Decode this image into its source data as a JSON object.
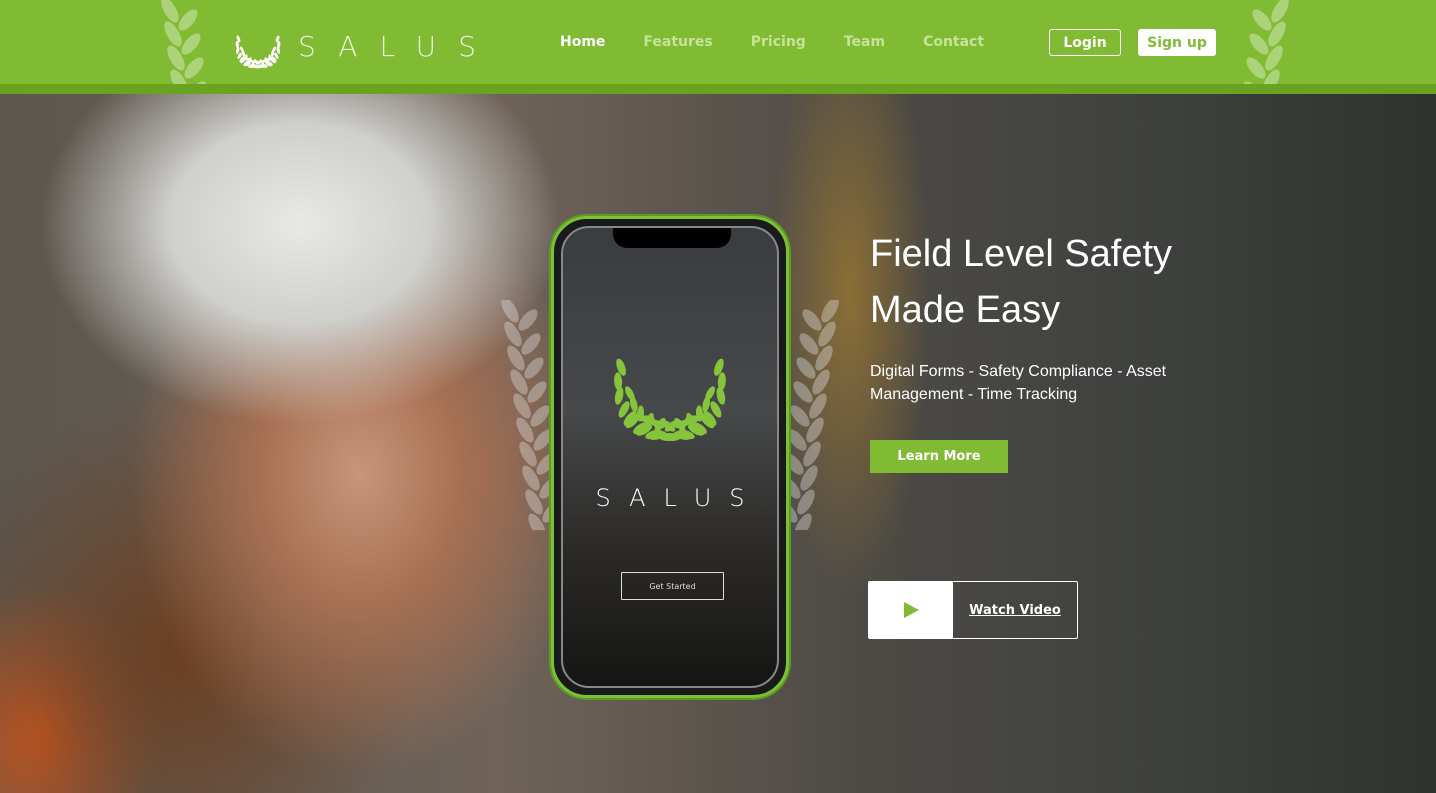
{
  "brand": {
    "name": "SALUS",
    "accent": "#80bb33"
  },
  "nav": {
    "items": [
      {
        "label": "Home",
        "active": true
      },
      {
        "label": "Features"
      },
      {
        "label": "Pricing"
      },
      {
        "label": "Team"
      },
      {
        "label": "Contact"
      }
    ],
    "login": "Login",
    "signup": "Sign up"
  },
  "hero": {
    "headline_1": "Field Level Safety",
    "headline_2": "Made Easy",
    "subtitle": "Digital Forms - Safety Compliance - Asset Management - Time Tracking",
    "learn_more": "Learn More",
    "watch_video": "Watch Video",
    "play_icon": "play-icon"
  },
  "phone": {
    "logo": "SALUS",
    "get_started": "Get Started"
  }
}
